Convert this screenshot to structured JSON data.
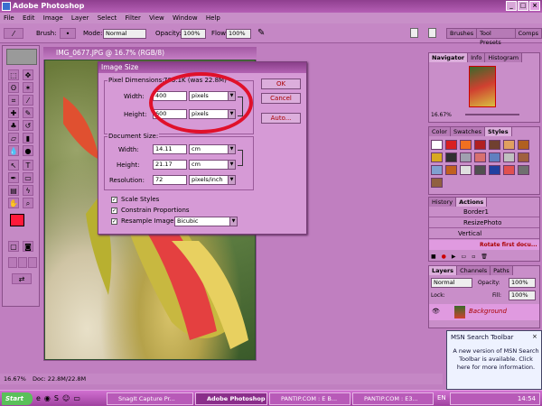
{
  "app": {
    "title": "Adobe Photoshop"
  },
  "menu": [
    "File",
    "Edit",
    "Image",
    "Layer",
    "Select",
    "Filter",
    "View",
    "Window",
    "Help"
  ],
  "options_bar": {
    "brush_label": "Brush:",
    "mode_label": "Mode:",
    "mode_value": "Normal",
    "opacity_label": "Opacity:",
    "opacity_value": "100%",
    "flow_label": "Flow:",
    "flow_value": "100%",
    "well_tabs": [
      "Brushes",
      "Tool Presets",
      "Comps"
    ]
  },
  "document": {
    "title": "IMG_0677.JPG @ 16.7% (RGB/8)"
  },
  "image_size": {
    "title": "Image Size",
    "pixel_dimensions_label": "Pixel Dimensions:",
    "pixel_dimensions_value": "703.1K (was 22.8M)",
    "width_label": "Width:",
    "width_value": "400",
    "width_unit": "pixels",
    "height_label": "Height:",
    "height_value": "600",
    "height_unit": "pixels",
    "document_size_label": "Document Size:",
    "doc_width_label": "Width:",
    "doc_width_value": "14.11",
    "doc_width_unit": "cm",
    "doc_height_label": "Height:",
    "doc_height_value": "21.17",
    "doc_height_unit": "cm",
    "resolution_label": "Resolution:",
    "resolution_value": "72",
    "resolution_unit": "pixels/inch",
    "scale_styles": "Scale Styles",
    "constrain": "Constrain Proportions",
    "resample_label": "Resample Image:",
    "resample_value": "Bicubic",
    "ok": "OK",
    "cancel": "Cancel",
    "auto": "Auto..."
  },
  "navigator": {
    "tabs": [
      "Navigator",
      "Info",
      "Histogram"
    ],
    "zoom": "16.67%"
  },
  "styles_panel": {
    "tabs": [
      "Color",
      "Swatches",
      "Styles"
    ],
    "swatches": [
      "#fff",
      "#d82020",
      "#f07020",
      "#b02020",
      "#704030",
      "#e0a060",
      "#b06020",
      "#d8a820",
      "#303030",
      "#a0a0b0",
      "#d87070",
      "#6080c0",
      "#c0c0c0",
      "#a06040",
      "#80a0d0",
      "#c06020",
      "#e0e0e0",
      "#505050",
      "#2040a0",
      "#e05050",
      "#707070",
      "#906040"
    ]
  },
  "actions_panel": {
    "tabs": [
      "History",
      "Actions"
    ],
    "items": [
      "Border1",
      "ResizePhoto",
      "Vertical",
      "Rotate first docu..."
    ]
  },
  "layers_panel": {
    "tabs": [
      "Layers",
      "Channels",
      "Paths"
    ],
    "mode": "Normal",
    "opacity_label": "Opacity:",
    "opacity_value": "100%",
    "lock_label": "Lock:",
    "fill_label": "Fill:",
    "fill_value": "100%",
    "layer_name": "Background"
  },
  "status": {
    "zoom": "16.67%",
    "doc": "Doc: 22.8M/22.8M"
  },
  "msn": {
    "title": "MSN Search Toolbar",
    "message": "A new version of MSN Search Toolbar is available. Click here for more information."
  },
  "taskbar": {
    "start": "Start",
    "tasks": [
      "SnagIt Capture Pr...",
      "Adobe Photoshop",
      "PANTIP.COM : E B...",
      "PANTIP.COM : E3..."
    ],
    "lang": "EN",
    "time": "14:54"
  }
}
